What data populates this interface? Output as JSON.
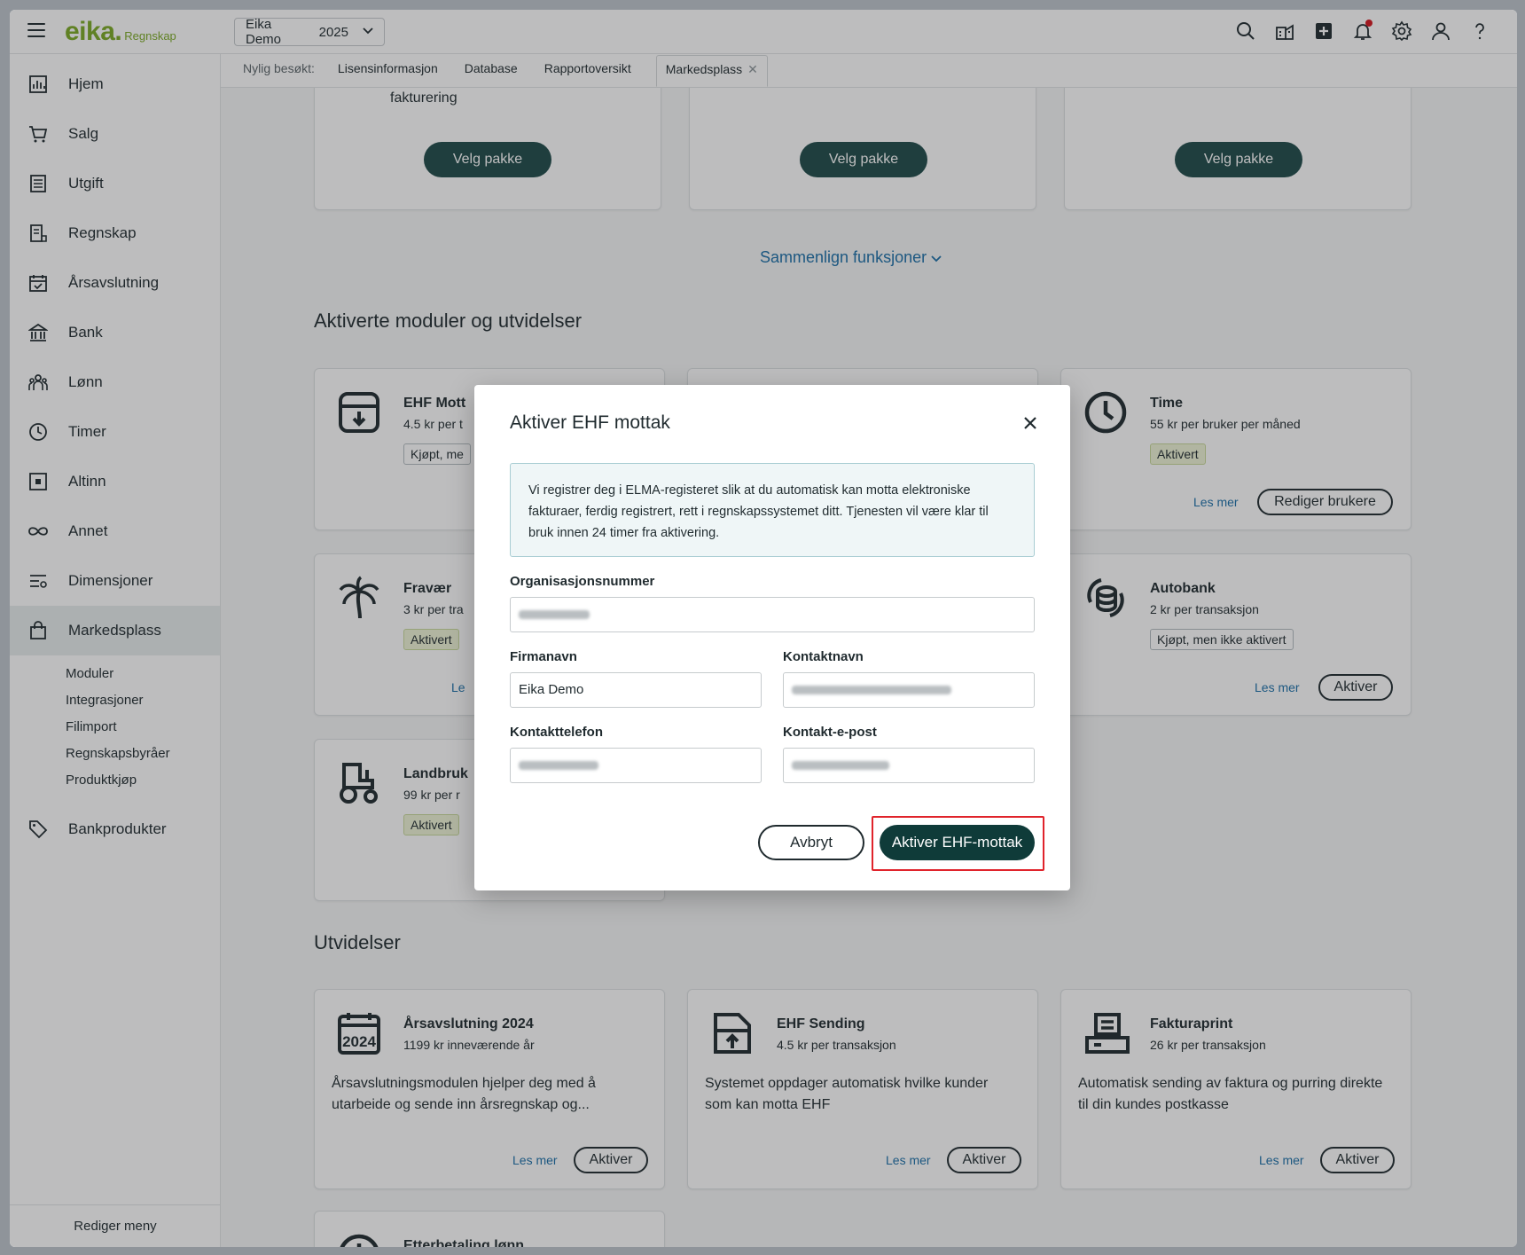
{
  "app": {
    "logo": "eika.",
    "logo_sub": "Regnskap",
    "company": "Eika Demo",
    "year": "2025"
  },
  "sidebar": {
    "items": [
      {
        "label": "Hjem",
        "icon": "chart-icon"
      },
      {
        "label": "Salg",
        "icon": "cart-icon"
      },
      {
        "label": "Utgift",
        "icon": "receipt-icon"
      },
      {
        "label": "Regnskap",
        "icon": "ledger-icon"
      },
      {
        "label": "Årsavslutning",
        "icon": "calendar-check-icon"
      },
      {
        "label": "Bank",
        "icon": "bank-icon"
      },
      {
        "label": "Lønn",
        "icon": "people-icon"
      },
      {
        "label": "Timer",
        "icon": "clock-icon"
      },
      {
        "label": "Altinn",
        "icon": "altinn-icon"
      },
      {
        "label": "Annet",
        "icon": "infinity-icon"
      },
      {
        "label": "Dimensjoner",
        "icon": "sliders-icon"
      },
      {
        "label": "Markedsplass",
        "icon": "bag-icon"
      }
    ],
    "sub_items": [
      "Moduler",
      "Integrasjoner",
      "Filimport",
      "Regnskapsbyråer",
      "Produktkjøp"
    ],
    "bankprodukter": "Bankprodukter",
    "edit_menu": "Rediger meny"
  },
  "tabs": {
    "recent_label": "Nylig besøkt:",
    "items": [
      "Lisensinformasjon",
      "Database",
      "Rapportoversikt"
    ],
    "active": "Markedsplass"
  },
  "packages": {
    "partial_text": "fakturering",
    "button": "Velg pakke",
    "compare": "Sammenlign funksjoner"
  },
  "activated": {
    "title": "Aktiverte moduler og utvidelser",
    "modules": [
      {
        "title": "EHF Mott",
        "sub": "4.5 kr per t",
        "tag": "Kjøpt, me"
      },
      {
        "title": "Time",
        "sub": "55 kr per bruker per måned",
        "tag": "Aktivert",
        "link": "Les mer",
        "button": "Rediger brukere"
      },
      {
        "title": "Fravær",
        "sub": "3 kr per tra",
        "tag": "Aktivert",
        "link": "Le"
      },
      {
        "title": "Autobank",
        "sub": "2 kr per transaksjon",
        "tag": "Kjøpt, men ikke aktivert",
        "link": "Les mer",
        "button": "Aktiver"
      },
      {
        "title": "Landbruk",
        "sub": "99 kr per r",
        "tag": "Aktivert"
      }
    ]
  },
  "extensions": {
    "title": "Utvidelser",
    "items": [
      {
        "title": "Årsavslutning 2024",
        "sub": "1199 kr inneværende år",
        "desc": "Årsavslutningsmodulen hjelper deg med å utarbeide og sende inn årsregnskap og...",
        "link": "Les mer",
        "button": "Aktiver"
      },
      {
        "title": "EHF Sending",
        "sub": "4.5 kr per transaksjon",
        "desc": "Systemet oppdager automatisk hvilke kunder som kan motta EHF",
        "link": "Les mer",
        "button": "Aktiver"
      },
      {
        "title": "Fakturaprint",
        "sub": "26 kr per transaksjon",
        "desc": "Automatisk sending av faktura og purring direkte til din kundes postkasse",
        "link": "Les mer",
        "button": "Aktiver"
      },
      {
        "title": "Etterbetaling lønn"
      }
    ]
  },
  "modal": {
    "title": "Aktiver EHF mottak",
    "info": "Vi registrer deg i ELMA-registeret slik at du automatisk kan motta elektroniske fakturaer, ferdig registrert, rett i regnskapssystemet ditt. Tjenesten vil være klar til bruk innen 24 timer fra aktivering.",
    "org_label": "Organisasjonsnummer",
    "firm_label": "Firmanavn",
    "firm_value": "Eika Demo",
    "contact_label": "Kontaktnavn",
    "phone_label": "Kontakttelefon",
    "email_label": "Kontakt-e-post",
    "cancel": "Avbryt",
    "confirm": "Aktiver EHF-mottak"
  },
  "colors": {
    "brand_green": "#7aaa23",
    "primary_dark": "#0f3b39",
    "link_blue": "#1a6fa8",
    "highlight_red": "#e0232b"
  }
}
